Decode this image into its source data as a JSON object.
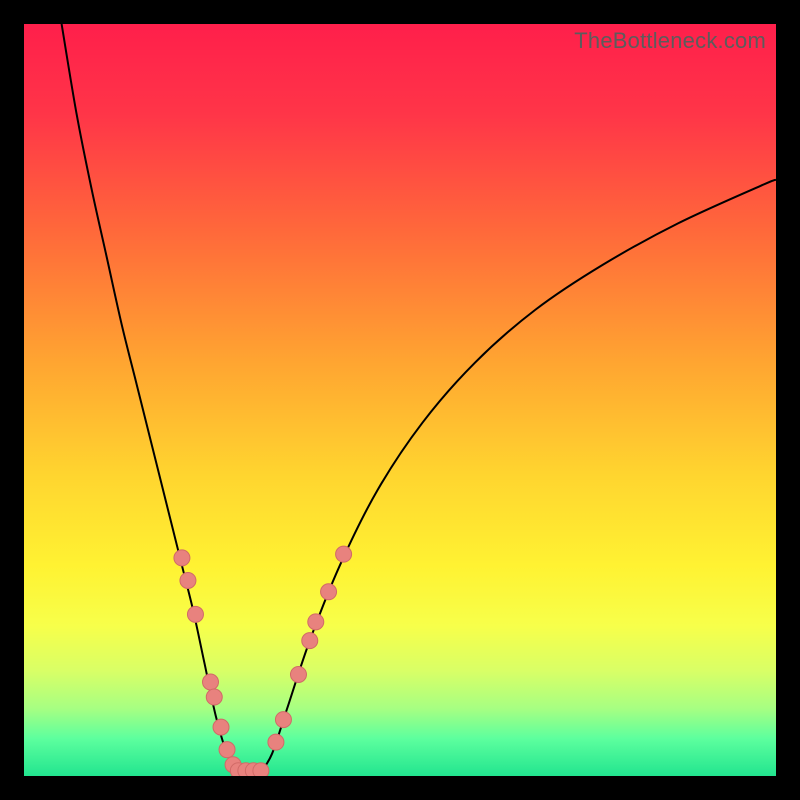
{
  "watermark": "TheBottleneck.com",
  "chart_data": {
    "type": "line",
    "title": "",
    "xlabel": "",
    "ylabel": "",
    "xlim": [
      0,
      100
    ],
    "ylim": [
      0,
      100
    ],
    "gradient_stops": [
      {
        "pct": 0,
        "color": "#ff1f4b"
      },
      {
        "pct": 12,
        "color": "#ff3548"
      },
      {
        "pct": 28,
        "color": "#ff6a3a"
      },
      {
        "pct": 45,
        "color": "#ffa531"
      },
      {
        "pct": 60,
        "color": "#ffd52f"
      },
      {
        "pct": 72,
        "color": "#fff232"
      },
      {
        "pct": 80,
        "color": "#f7ff4a"
      },
      {
        "pct": 86,
        "color": "#d9ff66"
      },
      {
        "pct": 91,
        "color": "#a7ff82"
      },
      {
        "pct": 95,
        "color": "#5dff9e"
      },
      {
        "pct": 100,
        "color": "#22e58f"
      }
    ],
    "series": [
      {
        "name": "left-curve",
        "x": [
          5,
          7,
          9,
          11,
          13,
          15,
          17,
          19,
          21,
          22.5,
          24,
          25.5,
          27,
          28.5
        ],
        "y": [
          100,
          88,
          78,
          69,
          60,
          52,
          44,
          36,
          28,
          22,
          15,
          8,
          3,
          0.5
        ]
      },
      {
        "name": "right-curve",
        "x": [
          31.5,
          33,
          35,
          38,
          42,
          47,
          53,
          60,
          68,
          77,
          87,
          98,
          100
        ],
        "y": [
          0.5,
          3,
          9,
          18,
          28,
          38,
          47,
          55,
          62,
          68,
          73.5,
          78.5,
          79.3
        ]
      },
      {
        "name": "flat-bottom",
        "x": [
          28.5,
          31.5
        ],
        "y": [
          0.5,
          0.5
        ]
      }
    ],
    "dots_left": [
      {
        "x": 21.0,
        "y": 29.0
      },
      {
        "x": 21.8,
        "y": 26.0
      },
      {
        "x": 22.8,
        "y": 21.5
      },
      {
        "x": 24.8,
        "y": 12.5
      },
      {
        "x": 25.3,
        "y": 10.5
      },
      {
        "x": 26.2,
        "y": 6.5
      },
      {
        "x": 27.0,
        "y": 3.5
      },
      {
        "x": 27.8,
        "y": 1.5
      }
    ],
    "dots_right": [
      {
        "x": 33.5,
        "y": 4.5
      },
      {
        "x": 34.5,
        "y": 7.5
      },
      {
        "x": 36.5,
        "y": 13.5
      },
      {
        "x": 38.0,
        "y": 18.0
      },
      {
        "x": 38.8,
        "y": 20.5
      },
      {
        "x": 40.5,
        "y": 24.5
      },
      {
        "x": 42.5,
        "y": 29.5
      }
    ],
    "dots_bottom": [
      {
        "x": 28.5,
        "y": 0.7
      },
      {
        "x": 29.5,
        "y": 0.7
      },
      {
        "x": 30.5,
        "y": 0.7
      },
      {
        "x": 31.5,
        "y": 0.7
      }
    ],
    "dot_radius": 8,
    "colors": {
      "curve": "#000000",
      "dot_fill": "#e8827e",
      "dot_stroke": "#d16a67",
      "frame": "#000000",
      "watermark": "#5c5c5c"
    }
  }
}
